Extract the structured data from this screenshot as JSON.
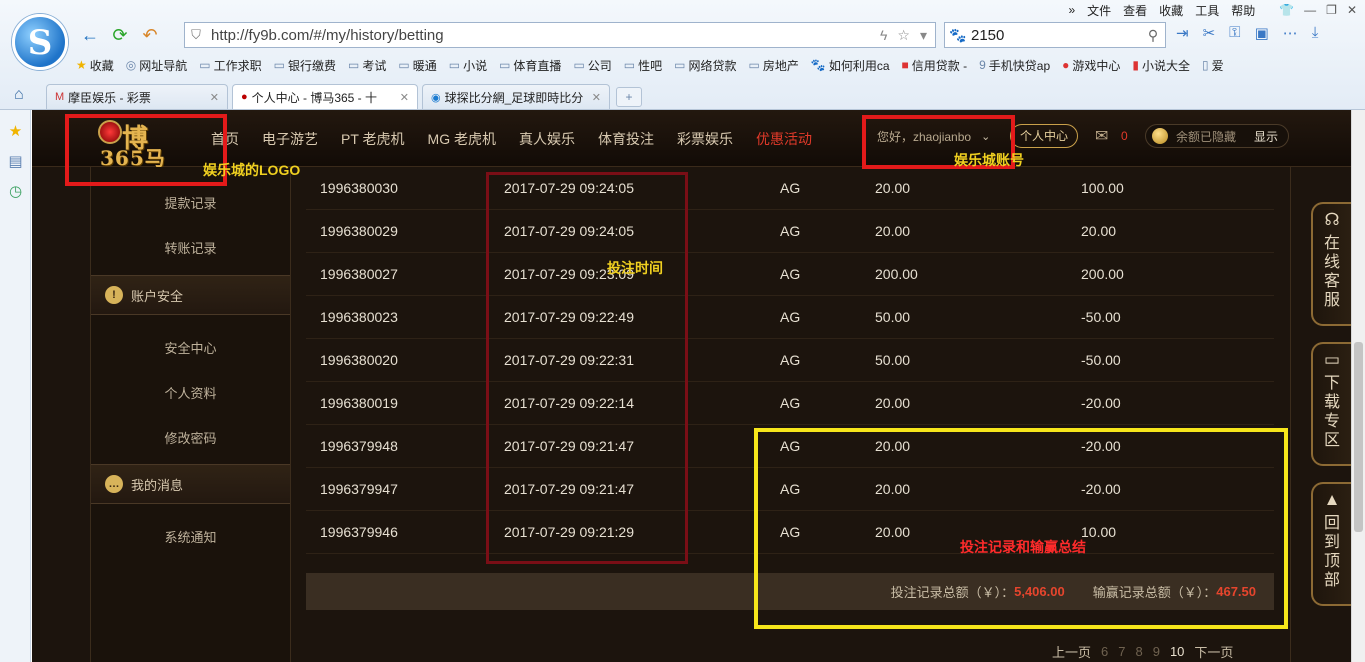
{
  "browser": {
    "menu": [
      "文件",
      "查看",
      "收藏",
      "工具",
      "帮助"
    ],
    "url": "http://fy9b.com/#/my/history/betting",
    "search_value": "2150",
    "bookmarks": [
      {
        "label": "收藏",
        "icon": "star-icon"
      },
      {
        "label": "网址导航",
        "icon": "globe-icon"
      },
      {
        "label": "工作求职",
        "icon": "folder-icon"
      },
      {
        "label": "银行缴费",
        "icon": "folder-icon"
      },
      {
        "label": "考试",
        "icon": "folder-icon"
      },
      {
        "label": "暖通",
        "icon": "folder-icon"
      },
      {
        "label": "小说",
        "icon": "folder-icon"
      },
      {
        "label": "体育直播",
        "icon": "folder-icon"
      },
      {
        "label": "公司",
        "icon": "folder-icon"
      },
      {
        "label": "性吧",
        "icon": "folder-icon"
      },
      {
        "label": "网络贷款",
        "icon": "folder-icon"
      },
      {
        "label": "房地产",
        "icon": "folder-icon"
      },
      {
        "label": "如何利用ca",
        "icon": "paw-icon"
      },
      {
        "label": "信用贷款 -",
        "icon": "badge-icon"
      },
      {
        "label": "手机快贷ap",
        "icon": "loan-icon"
      },
      {
        "label": "游戏中心",
        "icon": "game-icon"
      },
      {
        "label": "小说大全",
        "icon": "book-icon"
      },
      {
        "label": "爱",
        "icon": "page-icon"
      }
    ],
    "tabs": [
      {
        "label": "摩臣娱乐 - 彩票",
        "active": false
      },
      {
        "label": "个人中心 - 博马365 - 十",
        "active": true
      },
      {
        "label": "球探比分網_足球即時比分",
        "active": false
      }
    ]
  },
  "site": {
    "logo_text_top": "博",
    "logo_text_bottom": "365马",
    "nav": [
      "首页",
      "电子游艺",
      "PT 老虎机",
      "MG 老虎机",
      "真人娱乐",
      "体育投注",
      "彩票娱乐",
      "优惠活动"
    ],
    "greeting": "您好，zhaojianbo",
    "personal_center": "个人中心",
    "message_count": "0",
    "balance_hidden": "余额已隐藏",
    "show_label": "显示"
  },
  "sidebar": {
    "items_top": [
      "提款记录",
      "转账记录"
    ],
    "section_security": "账户安全",
    "items_security": [
      "安全中心",
      "个人资料",
      "修改密码"
    ],
    "section_messages": "我的消息",
    "items_messages": [
      "系统通知"
    ]
  },
  "table": {
    "rows": [
      {
        "id": "1996380030",
        "time": "2017-07-29 09:24:05",
        "platform": "AG",
        "bet": "20.00",
        "win": "100.00"
      },
      {
        "id": "1996380029",
        "time": "2017-07-29 09:24:05",
        "platform": "AG",
        "bet": "20.00",
        "win": "20.00"
      },
      {
        "id": "1996380027",
        "time": "2017-07-29 09:23:09",
        "platform": "AG",
        "bet": "200.00",
        "win": "200.00"
      },
      {
        "id": "1996380023",
        "time": "2017-07-29 09:22:49",
        "platform": "AG",
        "bet": "50.00",
        "win": "-50.00"
      },
      {
        "id": "1996380020",
        "time": "2017-07-29 09:22:31",
        "platform": "AG",
        "bet": "50.00",
        "win": "-50.00"
      },
      {
        "id": "1996380019",
        "time": "2017-07-29 09:22:14",
        "platform": "AG",
        "bet": "20.00",
        "win": "-20.00"
      },
      {
        "id": "1996379948",
        "time": "2017-07-29 09:21:47",
        "platform": "AG",
        "bet": "20.00",
        "win": "-20.00"
      },
      {
        "id": "1996379947",
        "time": "2017-07-29 09:21:47",
        "platform": "AG",
        "bet": "20.00",
        "win": "-20.00"
      },
      {
        "id": "1996379946",
        "time": "2017-07-29 09:21:29",
        "platform": "AG",
        "bet": "20.00",
        "win": "10.00"
      }
    ]
  },
  "summary": {
    "bet_label": "投注记录总额（￥）：",
    "bet_value": "5,406.00",
    "win_label": "输赢记录总额（￥）：",
    "win_value": "467.50"
  },
  "pager": {
    "prev": "上一页",
    "pages": [
      "6",
      "7",
      "8",
      "9",
      "10"
    ],
    "current": "10",
    "next": "下一页"
  },
  "float_buttons": [
    "在线客服",
    "下载专区",
    "回到顶部"
  ],
  "annotations": {
    "logo": "娱乐城的LOGO",
    "account": "娱乐城账号",
    "bet_time": "投注时间",
    "summary": "投注记录和输赢总结"
  },
  "colors": {
    "site_bg": "#1c140d",
    "promo_red": "#e23a2a",
    "gold": "#c9a04a",
    "annotation_red": "#e31a1a",
    "annotation_yellow": "#f6e61b"
  }
}
